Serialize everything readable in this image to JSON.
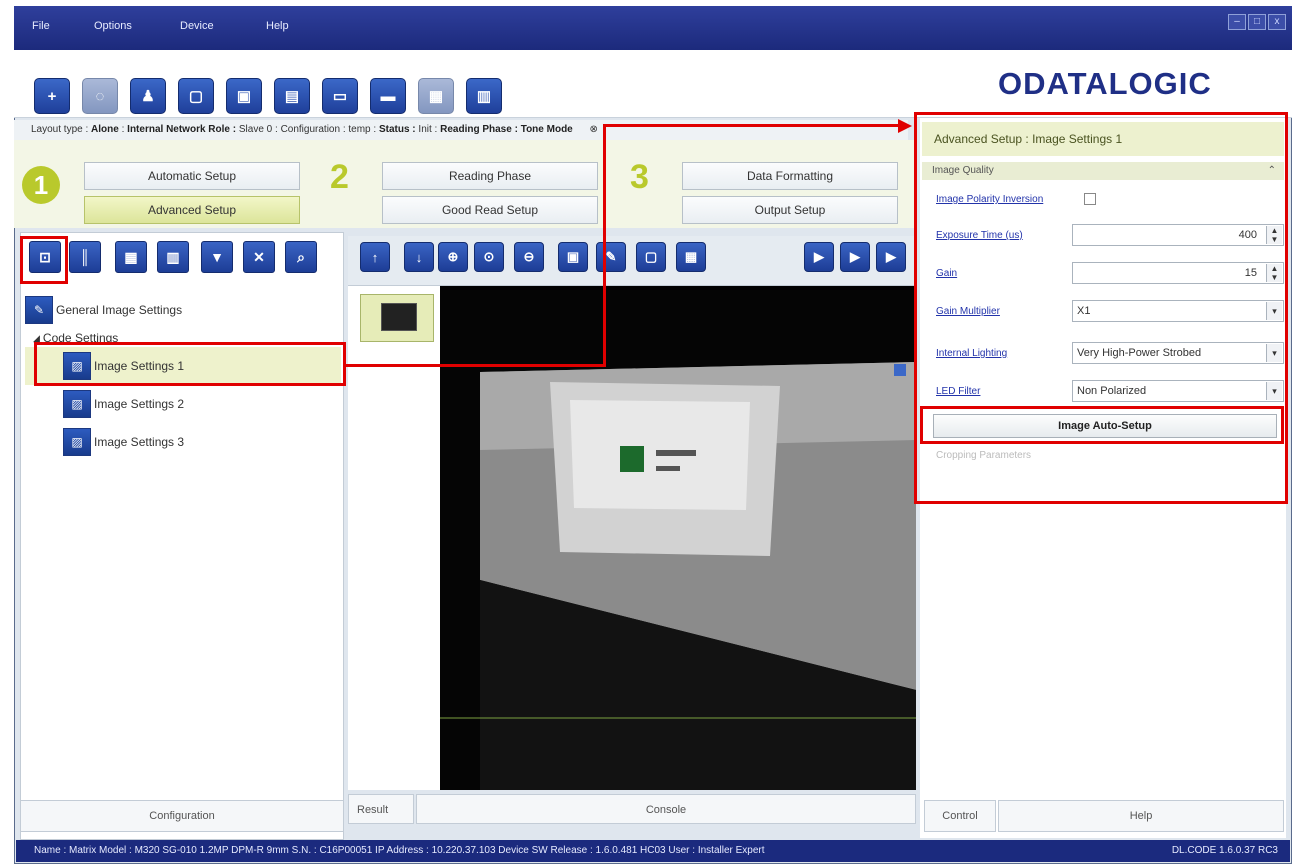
{
  "menu": [
    "File",
    "Options",
    "Device",
    "Help"
  ],
  "window_controls": [
    "–",
    "□",
    "x"
  ],
  "toolbar_icons": [
    "connect-icon",
    "disconnect-icon",
    "user-icon",
    "device-icon",
    "image-capture-icon",
    "image-settings-icon",
    "monitor-icon",
    "send-icon",
    "receive-icon",
    "statistics-icon"
  ],
  "brand": {
    "logo_text": "ODATALOGIC"
  },
  "status_line": {
    "layout_type_label": "Layout type :",
    "layout_type": "Alone",
    "role_label": "Internal Network Role :",
    "role": "Slave 0",
    "config_label": "Configuration :",
    "config": "temp",
    "status_label": "Status :",
    "status": "Init",
    "phase_label": "Reading Phase :",
    "phase": "Tone Mode"
  },
  "steps": [
    {
      "num": "1",
      "buttons": [
        "Automatic Setup",
        "Advanced Setup"
      ]
    },
    {
      "num": "2",
      "buttons": [
        "Reading Phase",
        "Good Read Setup"
      ]
    },
    {
      "num": "3",
      "buttons": [
        "Data Formatting",
        "Output Setup"
      ]
    }
  ],
  "left_tree": {
    "root": "General Image Settings",
    "group": "Code Settings",
    "items": [
      "Image Settings 1",
      "Image Settings 2",
      "Image Settings 3"
    ]
  },
  "left_tabs": [
    "Configuration"
  ],
  "center_tabs": [
    "Result",
    "Console"
  ],
  "right_tabs": [
    "Control",
    "Help"
  ],
  "right_panel": {
    "title": "Advanced Setup : Image Settings 1",
    "section": "Image Quality",
    "params": [
      {
        "label": "Image Polarity Inversion",
        "value": "",
        "kind": "check"
      },
      {
        "label": "Exposure Time (us)",
        "value": "400",
        "kind": "spin"
      },
      {
        "label": "Gain",
        "value": "15",
        "kind": "spin"
      },
      {
        "label": "Gain Multiplier",
        "value": "X1",
        "kind": "drop"
      },
      {
        "label": "Internal Lighting",
        "value": "Very High-Power Strobed",
        "kind": "drop"
      },
      {
        "label": "LED Filter",
        "value": "Non Polarized",
        "kind": "drop"
      }
    ],
    "auto_button": "Image Auto-Setup",
    "disabled_section": "Cropping Parameters"
  },
  "bottom_status": "Name : Matrix  Model : M320 SG-010 1.2MP DPM-R 9mm  S.N. : C16P00051  IP Address : 10.220.37.103  Device SW Release : 1.6.0.481 HC03  User : Installer Expert",
  "bottom_right": "DL.CODE 1.6.0.37 RC3"
}
